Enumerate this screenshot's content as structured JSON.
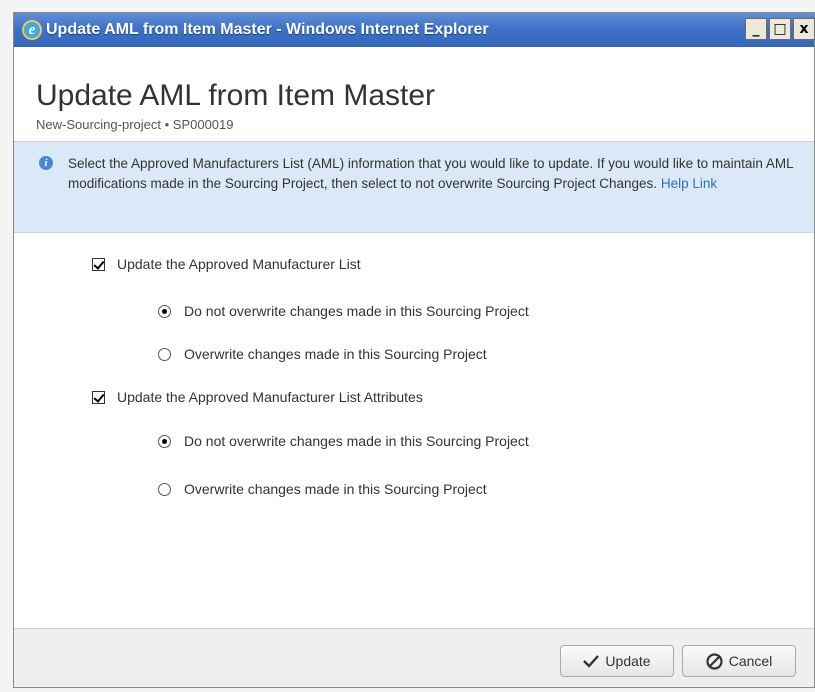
{
  "window": {
    "title": "Update AML from Item Master - Windows Internet Explorer",
    "controls": {
      "minimize": "_",
      "maximize": "□",
      "close": "x"
    }
  },
  "dialog": {
    "title": "Update AML from Item Master",
    "subtitle": "New-Sourcing-project • SP000019"
  },
  "info": {
    "text": "Select the Approved Manufacturers List (AML) information that you would like to update. If you would like to maintain AML modifications made in the Sourcing Project, then select to not overwrite Sourcing Project Changes.",
    "help_link": "Help Link"
  },
  "options": [
    {
      "label": "Update the Approved Manufacturer List",
      "checked": true,
      "choices": [
        {
          "label": "Do not overwrite changes made in this Sourcing Project",
          "selected": true
        },
        {
          "label": "Overwrite changes made in this Sourcing Project",
          "selected": false
        }
      ]
    },
    {
      "label": "Update the Approved Manufacturer List Attributes",
      "checked": true,
      "choices": [
        {
          "label": "Do not overwrite changes made in this Sourcing Project",
          "selected": true
        },
        {
          "label": "Overwrite changes made in this Sourcing Project",
          "selected": false
        }
      ]
    }
  ],
  "buttons": {
    "update": {
      "label": "Update",
      "icon": "checkmark-icon"
    },
    "cancel": {
      "label": "Cancel",
      "icon": "cancel-icon"
    }
  },
  "colors": {
    "titlebar": "#3f72c6",
    "info_banner": "#dbe8f7",
    "link": "#2f6fc2"
  }
}
